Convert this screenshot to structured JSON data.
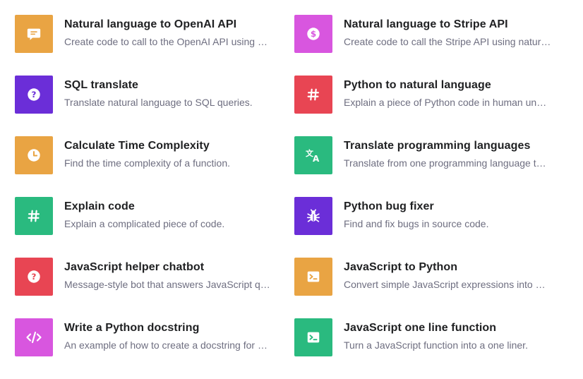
{
  "examples": [
    {
      "title": "Natural language to OpenAI API",
      "description": "Create code to call to the OpenAI API using a natural language instruction.",
      "icon": "chat-bubble-icon",
      "color": "#e9a443"
    },
    {
      "title": "Natural language to Stripe API",
      "description": "Create code to call the Stripe API using natural language.",
      "icon": "dollar-icon",
      "color": "#d856df"
    },
    {
      "title": "SQL translate",
      "description": "Translate natural language to SQL queries.",
      "icon": "question-icon",
      "color": "#6b2ed8"
    },
    {
      "title": "Python to natural language",
      "description": "Explain a piece of Python code in human understandable language.",
      "icon": "hashtag-icon",
      "color": "#e84553"
    },
    {
      "title": "Calculate Time Complexity",
      "description": "Find the time complexity of a function.",
      "icon": "clock-icon",
      "color": "#e9a443"
    },
    {
      "title": "Translate programming languages",
      "description": "Translate from one programming language to another.",
      "icon": "translate-icon",
      "color": "#2aba7f"
    },
    {
      "title": "Explain code",
      "description": "Explain a complicated piece of code.",
      "icon": "hashtag-icon",
      "color": "#2aba7f"
    },
    {
      "title": "Python bug fixer",
      "description": "Find and fix bugs in source code.",
      "icon": "bug-icon",
      "color": "#6b2ed8"
    },
    {
      "title": "JavaScript helper chatbot",
      "description": "Message-style bot that answers JavaScript questions.",
      "icon": "question-icon",
      "color": "#e84553"
    },
    {
      "title": "JavaScript to Python",
      "description": "Convert simple JavaScript expressions into Python.",
      "icon": "terminal-icon",
      "color": "#e9a443"
    },
    {
      "title": "Write a Python docstring",
      "description": "An example of how to create a docstring for a given Python function.",
      "icon": "code-icon",
      "color": "#d856df"
    },
    {
      "title": "JavaScript one line function",
      "description": "Turn a JavaScript function into a one liner.",
      "icon": "terminal-icon",
      "color": "#2aba7f"
    }
  ]
}
